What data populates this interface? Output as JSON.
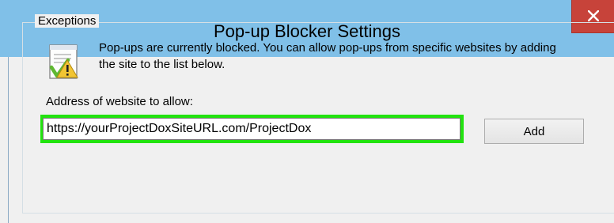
{
  "window": {
    "title": "Pop-up Blocker Settings",
    "close_icon": "close-icon",
    "accent_color": "#80c0e8",
    "close_color": "#c7433a"
  },
  "exceptions": {
    "group_label": "Exceptions",
    "info_icon": "blocked-popup-icon",
    "info_text": "Pop-ups are currently blocked.  You can allow pop-ups from specific websites by adding the site to the list below.",
    "address_label": "Address of website to allow:",
    "address_value": "https://yourProjectDoxSiteURL.com/ProjectDox",
    "highlight_color": "#22e30f",
    "add_button_label": "Add"
  }
}
